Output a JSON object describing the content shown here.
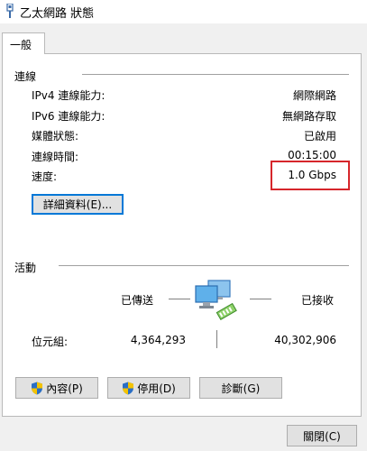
{
  "window": {
    "title": "乙太網路 狀態"
  },
  "tabs": [
    {
      "label": "一般"
    }
  ],
  "connection": {
    "heading": "連線",
    "rows": [
      {
        "label": "IPv4 連線能力:",
        "value": "網際網路"
      },
      {
        "label": "IPv6 連線能力:",
        "value": "無網路存取"
      },
      {
        "label": "媒體狀態:",
        "value": "已啟用"
      },
      {
        "label": "連線時間:",
        "value": "00:15:00"
      },
      {
        "label": "速度:",
        "value": "1.0 Gbps"
      }
    ],
    "details_button": "詳細資料(E)..."
  },
  "activity": {
    "heading": "活動",
    "sent_label": "已傳送",
    "received_label": "已接收",
    "bytes_label": "位元組:",
    "bytes_sent": "4,364,293",
    "bytes_received": "40,302,906"
  },
  "buttons": {
    "properties": "內容(P)",
    "disable": "停用(D)",
    "diagnose": "診斷(G)",
    "close": "關閉(C)"
  },
  "colors": {
    "highlight": "#d6262b",
    "focus": "#0078d7",
    "shield_blue": "#2b6fc6",
    "shield_yellow": "#f4c300"
  }
}
